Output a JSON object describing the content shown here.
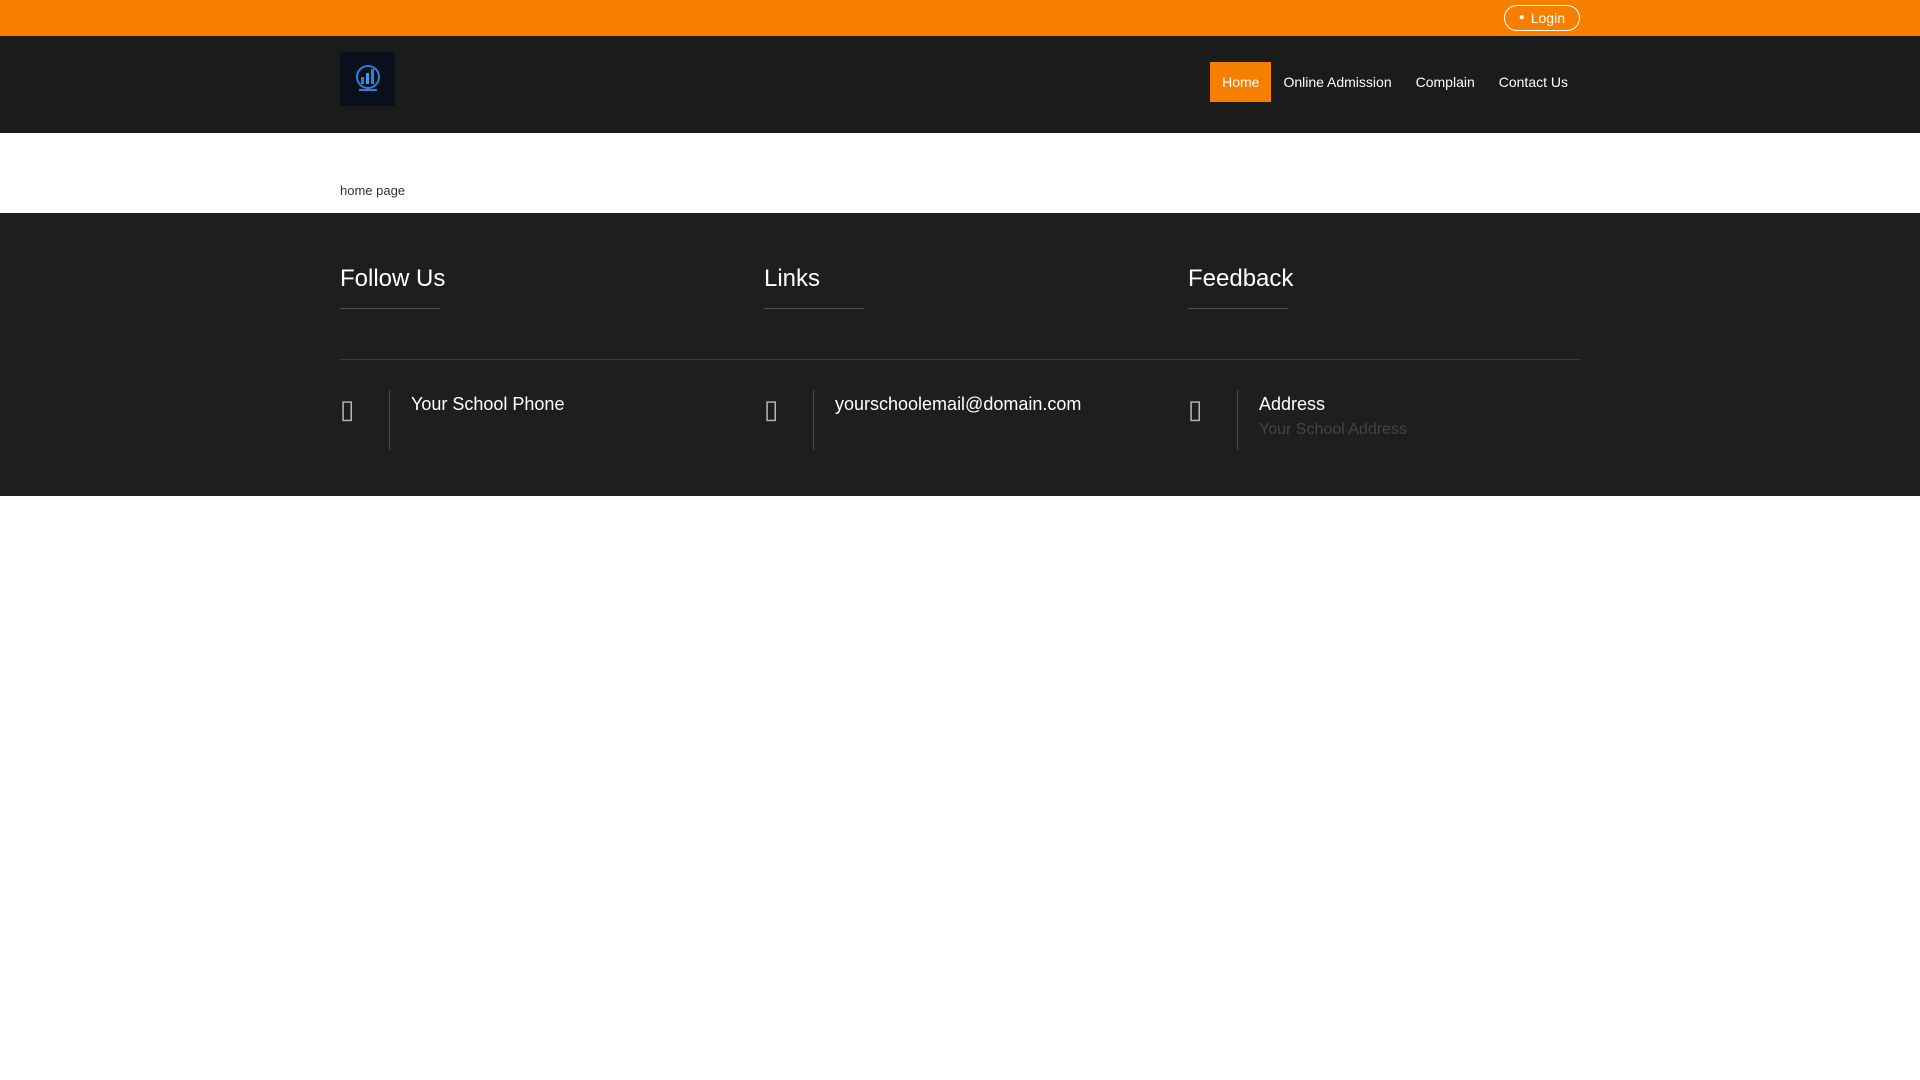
{
  "topbar": {
    "login_label": "Login",
    "login_icon": "user-icon",
    "color": "#f77f00"
  },
  "header": {
    "logo_icon": "bar-chart-logo-icon",
    "nav": [
      {
        "label": "Home",
        "active": true
      },
      {
        "label": "Online Admission",
        "active": false
      },
      {
        "label": "Complain",
        "active": false
      },
      {
        "label": "Contact Us",
        "active": false
      }
    ]
  },
  "main": {
    "text": "home page"
  },
  "footer": {
    "headings": [
      "Follow Us",
      "Links",
      "Feedback"
    ],
    "contact": [
      {
        "icon": "phone-icon",
        "main": "Your School Phone",
        "sub": ""
      },
      {
        "icon": "envelope-icon",
        "main": "yourschoolemail@domain.com",
        "sub": ""
      },
      {
        "icon": "map-marker-icon",
        "main": "Address",
        "sub": "Your School Address"
      }
    ]
  }
}
